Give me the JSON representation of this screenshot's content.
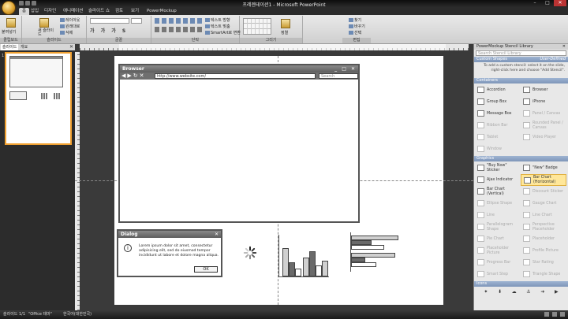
{
  "window": {
    "title": "프레젠테이션1 - Microsoft PowerPoint"
  },
  "tabs": [
    {
      "label": "홈"
    },
    {
      "label": "삽입"
    },
    {
      "label": "디자인"
    },
    {
      "label": "애니메이션"
    },
    {
      "label": "슬라이드 쇼"
    },
    {
      "label": "검토"
    },
    {
      "label": "보기"
    },
    {
      "label": "PowerMockup"
    }
  ],
  "ribbon": {
    "clipboard": {
      "label": "클립보드",
      "paste": "붙여넣기"
    },
    "slides": {
      "label": "슬라이드",
      "new_slide": "새 슬라이드",
      "layout": "레이아웃",
      "reset": "원래대로",
      "delete": "삭제"
    },
    "font": {
      "label": "글꼴"
    },
    "paragraph": {
      "label": "단락",
      "text_direction": "텍스트 방향",
      "align_text": "텍스트 맞춤",
      "smartart": "SmartArt로 변환"
    },
    "drawing": {
      "label": "그리기",
      "arrange": "정렬"
    },
    "editing": {
      "label": "편집",
      "find": "찾기",
      "replace": "바꾸기",
      "select": "선택"
    }
  },
  "left_panel": {
    "tabs": [
      "슬라이드",
      "개요"
    ],
    "slide_number": "1"
  },
  "slide": {
    "browser": {
      "title": "Browser",
      "url": "http://www.website.com/",
      "search_placeholder": "Search"
    },
    "dialog": {
      "title": "Dialog",
      "icon_glyph": "i",
      "text": "Lorem ipsum dolor sit amet, consectetur adipisicing elit, sed do eiusmod tempor incididunt ut labore et dolore magna aliqua.",
      "ok_label": "OK"
    }
  },
  "right_panel": {
    "title": "PowerMockup Stencil Library",
    "search_placeholder": "Search Stencil Library",
    "custom_shapes": {
      "label": "Custom Shapes",
      "user_defined": "User-Defined",
      "hint": "To add a custom stencil: select it on the slide, right-click here and choose \"Add Stencil\"."
    },
    "containers": {
      "label": "Containers",
      "items": [
        {
          "label": "Accordion",
          "dim": false
        },
        {
          "label": "Browser",
          "dim": false
        },
        {
          "label": "Group Box",
          "dim": false
        },
        {
          "label": "iPhone",
          "dim": false
        },
        {
          "label": "Message Box",
          "dim": false
        },
        {
          "label": "Panel / Canvas",
          "dim": true
        },
        {
          "label": "Ribbon Bar",
          "dim": true
        },
        {
          "label": "Rounded Panel / Canvas",
          "dim": true
        },
        {
          "label": "Tablet",
          "dim": true
        },
        {
          "label": "Video Player",
          "dim": true
        },
        {
          "label": "Window",
          "dim": true
        }
      ]
    },
    "graphics": {
      "label": "Graphics",
      "items": [
        {
          "label": "\"Buy Now\" Sticker",
          "dim": false
        },
        {
          "label": "\"New\" Badge",
          "dim": false
        },
        {
          "label": "Ajax Indicator",
          "dim": false
        },
        {
          "label": "Bar Chart (Horizontal)",
          "dim": false,
          "selected": true
        },
        {
          "label": "Bar Chart (Vertical)",
          "dim": false
        },
        {
          "label": "Discount Sticker",
          "dim": true
        },
        {
          "label": "Ellipse Shape",
          "dim": true
        },
        {
          "label": "Gauge Chart",
          "dim": true
        },
        {
          "label": "Line",
          "dim": true
        },
        {
          "label": "Line Chart",
          "dim": true
        },
        {
          "label": "Parallelogram Shape",
          "dim": true
        },
        {
          "label": "Perspective Placeholder",
          "dim": true
        },
        {
          "label": "Pie Chart",
          "dim": true
        },
        {
          "label": "Placeholder",
          "dim": true
        },
        {
          "label": "Placeholder Picture",
          "dim": true
        },
        {
          "label": "Profile Picture",
          "dim": true
        },
        {
          "label": "Progress Bar",
          "dim": true
        },
        {
          "label": "Star Rating",
          "dim": true
        },
        {
          "label": "Smart Step",
          "dim": true
        },
        {
          "label": "Triangle Shape",
          "dim": true
        }
      ]
    },
    "icons": {
      "label": "Icons"
    }
  },
  "status": {
    "slide": "슬라이드 1/1",
    "theme": "\"Office 테마\"",
    "language": "한국어(대한민국)"
  }
}
